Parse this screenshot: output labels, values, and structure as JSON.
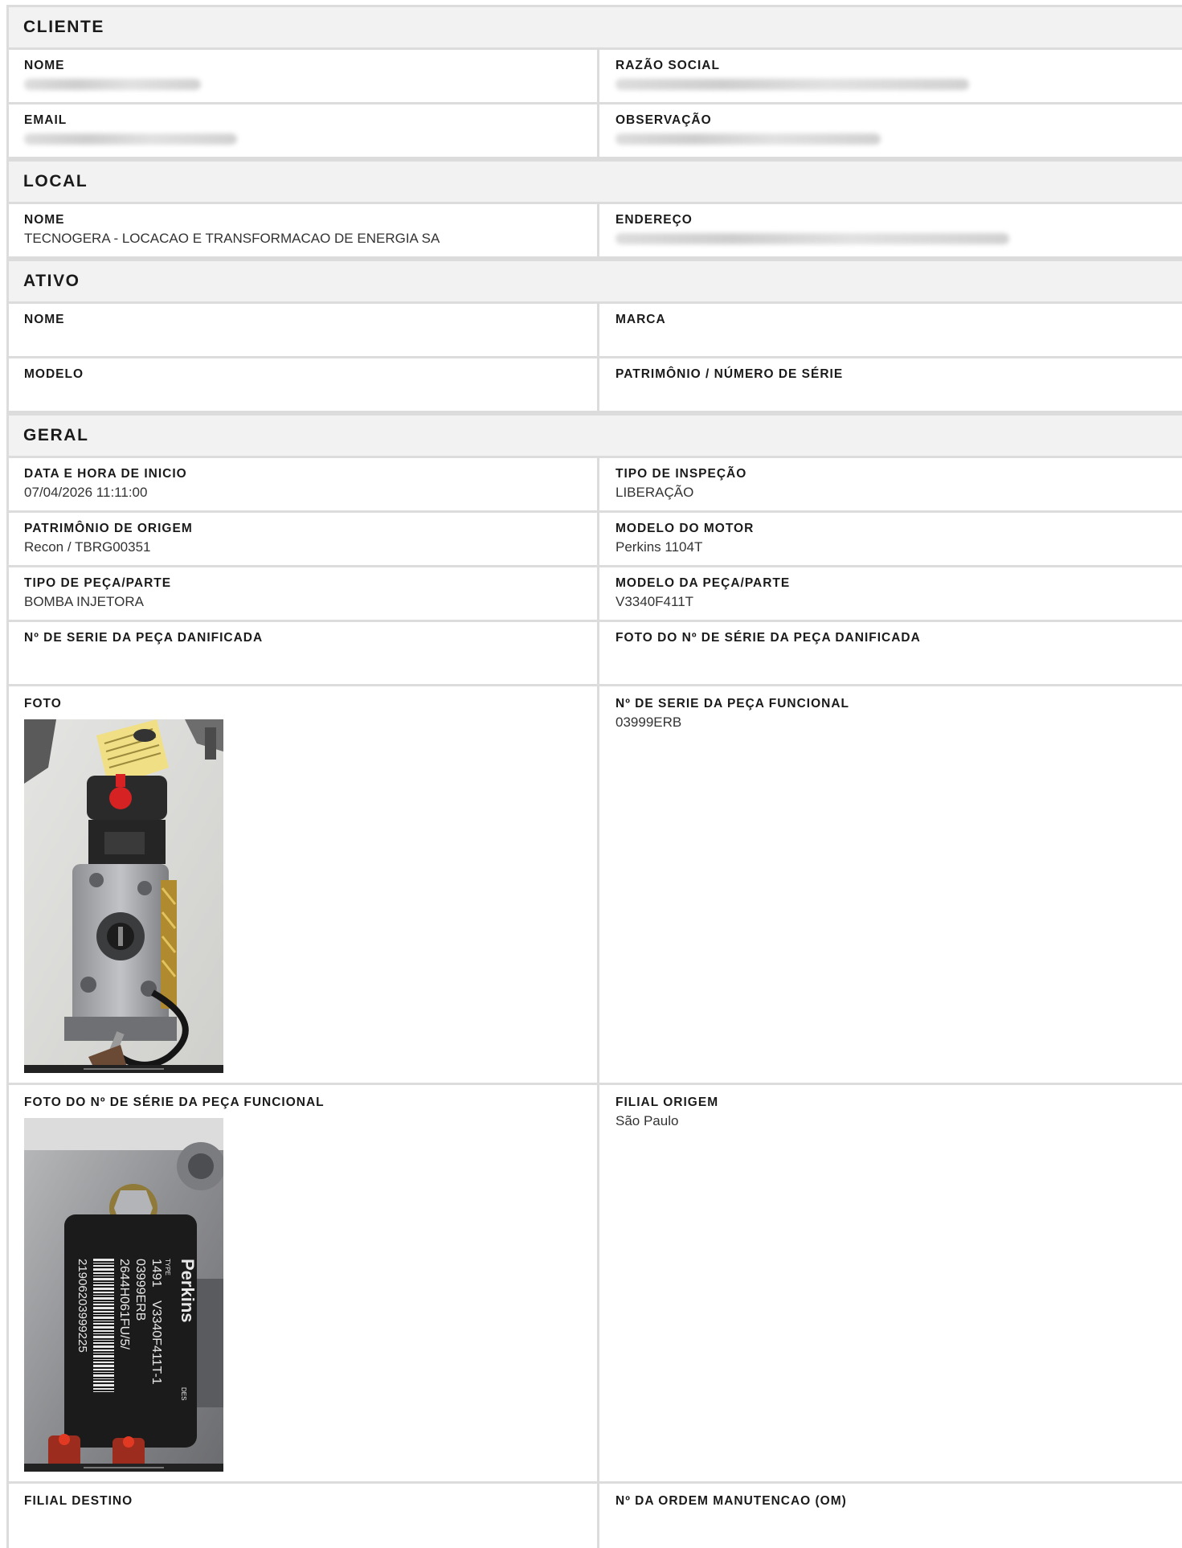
{
  "cliente": {
    "title": "CLIENTE",
    "nome_label": "NOME",
    "razao_label": "RAZÃO SOCIAL",
    "email_label": "EMAIL",
    "obs_label": "OBSERVAÇÃO"
  },
  "local": {
    "title": "LOCAL",
    "nome_label": "NOME",
    "nome_value": "TECNOGERA - LOCACAO E TRANSFORMACAO DE ENERGIA SA",
    "endereco_label": "ENDEREÇO"
  },
  "ativo": {
    "title": "ATIVO",
    "nome_label": "NOME",
    "marca_label": "MARCA",
    "modelo_label": "MODELO",
    "patrimonio_label": "PATRIMÔNIO / NÚMERO DE SÉRIE"
  },
  "geral": {
    "title": "GERAL",
    "data_label": "DATA E HORA DE INICIO",
    "data_value": "07/04/2026 11:11:00",
    "tipo_inspecao_label": "TIPO DE INSPEÇÃO",
    "tipo_inspecao_value": "LIBERAÇÃO",
    "patrimonio_origem_label": "PATRIMÔNIO DE ORIGEM",
    "patrimonio_origem_value": "Recon / TBRG00351",
    "modelo_motor_label": "MODELO DO MOTOR",
    "modelo_motor_value": "Perkins 1104T",
    "tipo_peca_label": "TIPO DE PEÇA/PARTE",
    "tipo_peca_value": "BOMBA INJETORA",
    "modelo_peca_label": "MODELO DA PEÇA/PARTE",
    "modelo_peca_value": "V3340F411T",
    "serie_danificada_label": "Nº DE SERIE DA PEÇA DANIFICADA",
    "foto_serie_danificada_label": "FOTO DO Nº DE SÉRIE DA PEÇA DANIFICADA",
    "foto_label": "FOTO",
    "serie_funcional_label": "Nº DE SERIE DA PEÇA FUNCIONAL",
    "serie_funcional_value": "03999ERB",
    "foto_serie_funcional_label": "FOTO DO Nº DE SÉRIE DA PEÇA FUNCIONAL",
    "filial_origem_label": "FILIAL ORIGEM",
    "filial_origem_value": "São Paulo",
    "filial_destino_label": "FILIAL DESTINO",
    "ordem_label": "Nº DA ORDEM MANUTENCAO (OM)"
  },
  "plate": {
    "brand": "Perkins",
    "type_word": "TYPE",
    "des_word": "DES",
    "line1": "1491",
    "line1b": "V3340F411T-1",
    "line2": "03999ERB",
    "line3": "2644H061FU/5/",
    "barcode": "21906203999225"
  }
}
